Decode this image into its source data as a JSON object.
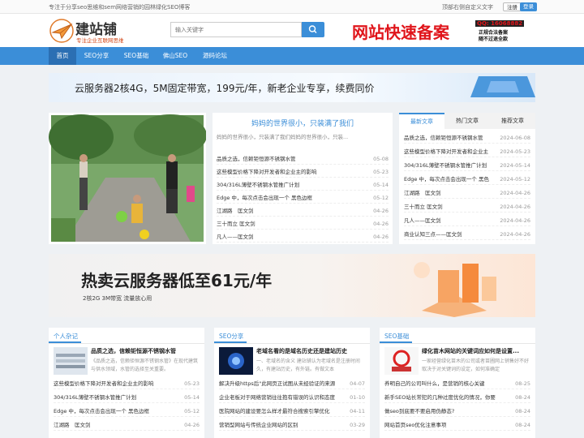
{
  "topbar": {
    "left_text": "专注于分享seo思维和sem网络营销的园林绿化SEO博客",
    "right_text": "顶部右侧自定义文字",
    "register": "注册",
    "login": "登录"
  },
  "logo": {
    "title": "建站铺",
    "subtitle": "专注企业互联网思维"
  },
  "search": {
    "placeholder": "输入关键字"
  },
  "header_ad": {
    "big": "网站快速备案",
    "qq": "QQ: 16068882",
    "line1": "正规合法备案",
    "line2": "随不过退全款"
  },
  "nav": [
    "首页",
    "SEO分享",
    "SEO基础",
    "佛山SEO",
    "源码论坛"
  ],
  "banner1": "云服务器2核4G，5M固定带宽，199元/年，新老企业专享，续费同价",
  "featured": {
    "title": "妈妈的世界很小，只装满了我们",
    "desc": "妈妈的世界很小，只装满了我们妈妈的世界很小，只装...",
    "items": [
      {
        "t": "品质之选，信赖钜恒源不锈钢水管",
        "d": "05-08"
      },
      {
        "t": "这些模型价格下降对开发者和企业主的影响",
        "d": "05-23"
      },
      {
        "t": "304/316L薄壁不锈钢水管推广计划",
        "d": "05-14"
      },
      {
        "t": "Edge 中，每次点击会出现一个 黑色边框",
        "d": "05-12"
      },
      {
        "t": "江湖路　匡文剑",
        "d": "04-26"
      },
      {
        "t": "三十而立 匡文剑",
        "d": "04-26"
      },
      {
        "t": "凡人——匡文剑",
        "d": "04-26"
      }
    ]
  },
  "tabs": {
    "labels": [
      "最新文章",
      "热门文章",
      "推荐文章"
    ],
    "items": [
      {
        "t": "品质之选，信赖钜恒源不锈钢水管",
        "d": "2024-06-08"
      },
      {
        "t": "这些模型价格下降对开发者和企业主",
        "d": "2024-05-23"
      },
      {
        "t": "304/316L薄壁不锈钢水管推广计划",
        "d": "2024-05-14"
      },
      {
        "t": "Edge 中，每次点击会出现一个 黑色",
        "d": "2024-05-12"
      },
      {
        "t": "江湖路　匡文剑",
        "d": "2024-04-26"
      },
      {
        "t": "三十而立 匡文剑",
        "d": "2024-04-26"
      },
      {
        "t": "凡人——匡文剑",
        "d": "2024-04-26"
      },
      {
        "t": "商业认知三点——匡文剑",
        "d": "2024-04-26"
      }
    ]
  },
  "banner2": {
    "big": "热卖云服务器低至61元/年",
    "small": "2核2G 3M带宽 流量放心用"
  },
  "columns": [
    {
      "name": "个人杂记",
      "title": "品质之选，信赖钜恒源不锈钢水管",
      "desc": "《品质之选，信赖钜恒源不锈钢水管》在现代建筑与供水领域，水管的选择至关重要。",
      "items": [
        {
          "t": "这些模型价格下降对开发者和企业主的影响",
          "d": "05-23"
        },
        {
          "t": "304/316L薄壁不锈钢水管推广计划",
          "d": "05-14"
        },
        {
          "t": "Edge 中，每次点击会出现一个 黑色边框",
          "d": "05-12"
        },
        {
          "t": "江湖路　匡文剑",
          "d": "04-26"
        }
      ]
    },
    {
      "name": "SEO分享",
      "title": "老域名看的是域名历史还是建站历史",
      "desc": "一、老域名的含义 建站铺认为老域名是注册时间久，有建站历史，有外链。有做文本",
      "items": [
        {
          "t": "解决升级https后\"此网页正试图从未经验证的来源",
          "d": "04-07"
        },
        {
          "t": "企业老板对于网络营销往往抱有错误的认识和态度",
          "d": "01-10"
        },
        {
          "t": "医院网站的建设要怎么样才最符合搜索引擎优化",
          "d": "04-11"
        },
        {
          "t": "营销型网站与传统企业网站的区别",
          "d": "03-29"
        }
      ]
    },
    {
      "name": "SEO基础",
      "title": "绿化苗木网站的关键词应如何是设置...",
      "desc": "一家经营绿化苗木的公司或者苗圃网上销售好不好取决于对关键词的设定，如何准确定",
      "items": [
        {
          "t": "养明自己的公司叫什么，是营销的核心关键",
          "d": "08-25"
        },
        {
          "t": "新手SEO站长常犯的几种过度优化的情况，你要",
          "d": "08-24"
        },
        {
          "t": "做seo到底要不要启用伪静态?",
          "d": "08-24"
        },
        {
          "t": "网站首页seo优化注意事项",
          "d": "08-24"
        }
      ]
    }
  ]
}
